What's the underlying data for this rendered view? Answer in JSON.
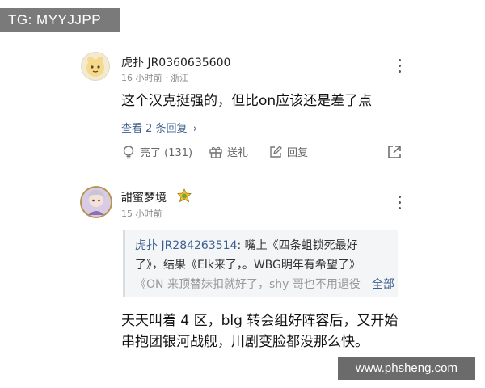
{
  "watermark": {
    "tg": "TG: MYYJJPP",
    "site": "www.phsheng.com"
  },
  "comments": [
    {
      "username": "虎扑 JR0360635600",
      "time": "16 小时前",
      "location": "浙江",
      "content": "这个汉克挺强的，但比on应该还是差了点",
      "replies_link": "查看 2 条回复",
      "likes_label": "亮了 (131)",
      "gift_label": "送礼",
      "reply_label": "回复"
    },
    {
      "username": "甜蜜梦境",
      "time": "15 小时前",
      "quote_user": "虎扑 JR284263514",
      "quote_line1": ": 嘴上《四条蛆锁死最好",
      "quote_line2": "了》，结果《Elk来了，。WBG明年有希望了》",
      "quote_line3": "《ON 来顶替妹扣就好了，shy 哥也不用退役",
      "expand_label": "全部",
      "content_line1": "天天叫着 4 区，blg 转会组好阵容后，又开始",
      "content_line2": "串抱团银河战舰，川剧变脸都没那么快。"
    }
  ],
  "icons": [
    "more-vertical-icon",
    "lightbulb-icon",
    "gift-icon",
    "edit-icon",
    "share-icon",
    "chevron-right-icon",
    "verified-badge-icon"
  ],
  "colors": {
    "link": "#3c5f8e",
    "meta": "#8a8a8a",
    "watermark_bg": "#7a7a7a"
  }
}
